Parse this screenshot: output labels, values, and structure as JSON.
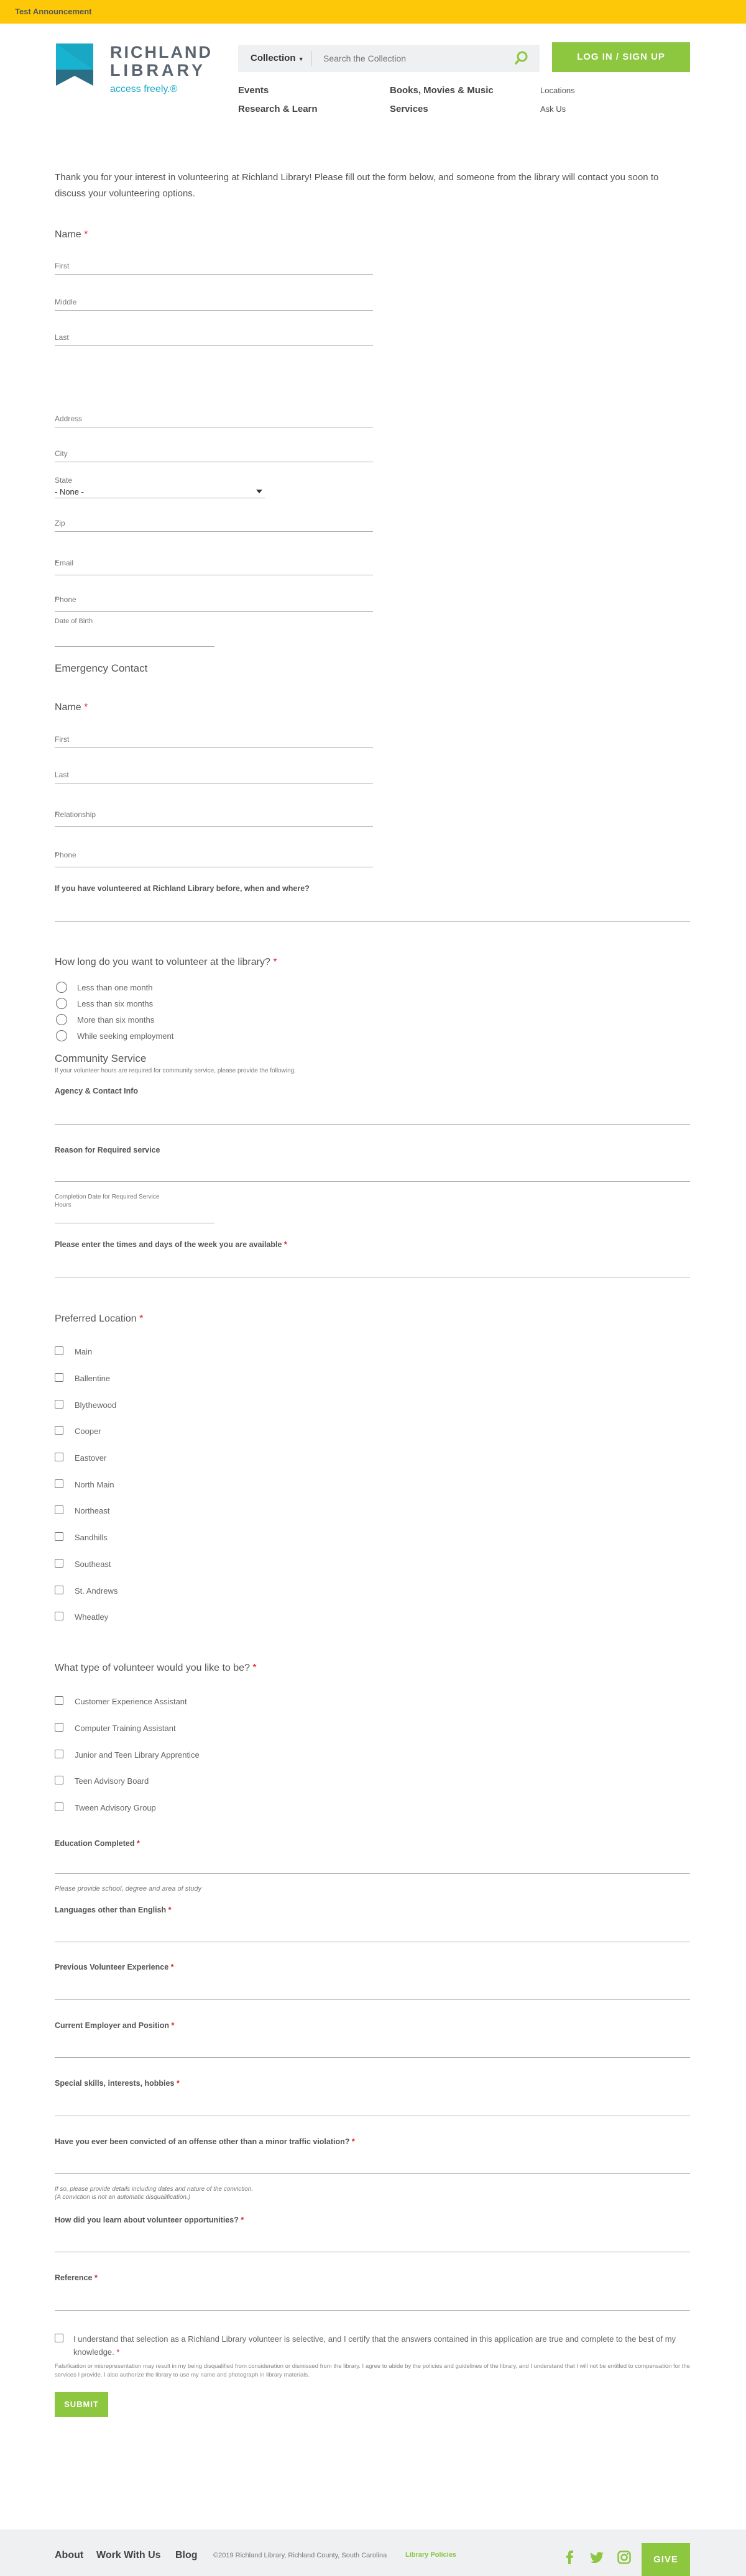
{
  "announcement": "Test Announcement",
  "logo": {
    "line1": "RICHLAND",
    "line2": "LIBRARY",
    "tagline": "access freely.®"
  },
  "search": {
    "scope": "Collection",
    "placeholder": "Search the Collection"
  },
  "login_label": "LOG IN / SIGN UP",
  "nav": {
    "events": "Events",
    "books": "Books, Movies & Music",
    "research": "Research & Learn",
    "services": "Services",
    "locations": "Locations",
    "ask": "Ask Us"
  },
  "intro": "Thank you for your interest in volunteering at Richland Library! Please fill out the form below, and someone from the library will contact you soon to discuss your volunteering options.",
  "name_section": {
    "title": "Name",
    "first": "First",
    "middle": "Middle",
    "last": "Last"
  },
  "address": {
    "address": "Address",
    "city": "City",
    "state_label": "State",
    "state_value": "- None -",
    "zip": "Zip"
  },
  "email": "Email",
  "phone": "Phone",
  "dob": "Date of Birth",
  "emergency": {
    "title": "Emergency Contact",
    "name": "Name",
    "first": "First",
    "last": "Last",
    "relationship": "Relationship",
    "phone": "Phone"
  },
  "volunteered_before": "If you have volunteered at Richland Library before, when and where?",
  "duration": {
    "question": "How long do you want to volunteer at the library?",
    "options": [
      "Less than one month",
      "Less than six months",
      "More than six months",
      "While seeking employment"
    ]
  },
  "community": {
    "title": "Community Service",
    "help": "If your volunteer hours are required for community service, please provide the following.",
    "agency": "Agency & Contact Info",
    "reason": "Reason for Required service",
    "completion": "Completion Date for Required Service",
    "hours": "Hours"
  },
  "availability": "Please enter the times and days of the week you are available",
  "locations": {
    "title": "Preferred Location",
    "items": [
      "Main",
      "Ballentine",
      "Blythewood",
      "Cooper",
      "Eastover",
      "North Main",
      "Northeast",
      "Sandhills",
      "Southeast",
      "St. Andrews",
      "Wheatley"
    ]
  },
  "volunteer_type": {
    "title": "What type of volunteer would you like to be?",
    "items": [
      "Customer Experience Assistant",
      "Computer Training Assistant",
      "Junior and Teen Library Apprentice",
      "Teen Advisory Board",
      "Tween Advisory Group"
    ]
  },
  "education": {
    "label": "Education Completed",
    "help": "Please provide school, degree and area of study"
  },
  "languages": "Languages other than English",
  "previous": "Previous Volunteer Experience",
  "employer": "Current Employer and Position",
  "skills": "Special skills, interests, hobbies",
  "convicted": {
    "label": "Have you ever been convicted of an offense other than a minor traffic violation?",
    "help1": "If so, please provide details including dates and nature of the conviction.",
    "help2": "(A conviction is not an automatic disqualification.)"
  },
  "learn": "How did you learn about volunteer opportunities?",
  "reference": "Reference",
  "certify": {
    "text": "I understand that selection as a Richland Library volunteer is selective, and I certify that the answers contained in this application are true and complete to the best of my knowledge.",
    "fine": "Falsification or misrepresentation may result in my being disqualified from consideration or dismissed from the library. I agree to abide by the policies and guidelines of the library, and I understand that I will not be entitled to compensation for the services I provide. I also authorize the library to use my name and photograph in library materials."
  },
  "submit": "SUBMIT",
  "footer": {
    "about": "About",
    "work": "Work With Us",
    "blog": "Blog",
    "copyright": "©2019 Richland Library, Richland County, South Carolina",
    "policies": "Library Policies",
    "give": "GIVE"
  },
  "colors": {
    "accent": "#8dc63f",
    "announcement": "#fdc807",
    "teal": "#1aa7c4",
    "required": "#d9232d"
  }
}
